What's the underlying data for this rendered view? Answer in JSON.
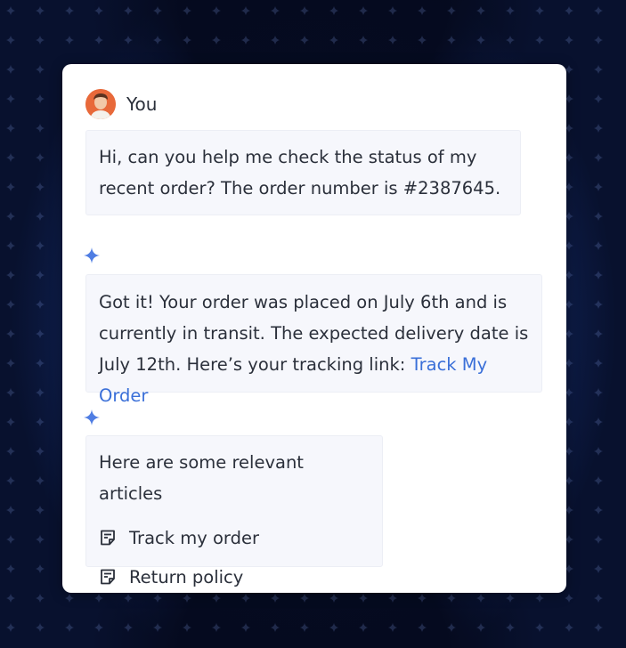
{
  "user": {
    "name": "You"
  },
  "messages": {
    "user_message": "Hi, can you help me check the status of my recent order? The order number is #2387645.",
    "assistant_line1": "Got it! Your order was placed on July 6th and is",
    "assistant_line2": "currently in transit. The expected delivery date is",
    "assistant_line3": "July 12th. Here’s your tracking link:",
    "assistant_link": "Track My Order"
  },
  "articles": {
    "title": "Here are some relevant articles",
    "items": [
      {
        "label": "Track my order",
        "icon": "document-icon"
      },
      {
        "label": "Return policy",
        "icon": "document-icon"
      }
    ]
  },
  "colors": {
    "accent": "#3a6fd8",
    "sparkle": "#4f7de3",
    "bubble_bg": "#f6f7fc",
    "avatar": "#e8693a"
  }
}
